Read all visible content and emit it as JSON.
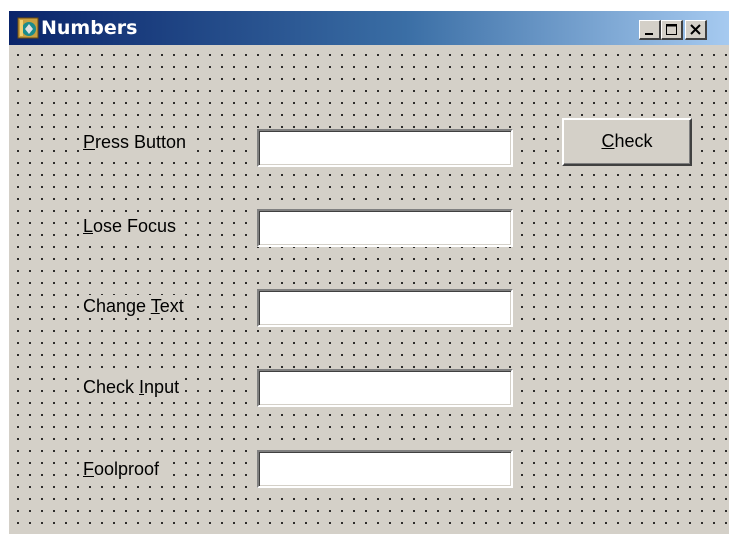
{
  "window": {
    "title": "Numbers",
    "controls": {
      "minimize_icon": "minimize-icon",
      "maximize_icon": "maximize-icon",
      "close_icon": "close-icon"
    }
  },
  "form": {
    "rows": [
      {
        "label_pre": "",
        "label_key": "P",
        "label_post": "ress Button",
        "value": ""
      },
      {
        "label_pre": "",
        "label_key": "L",
        "label_post": "ose Focus",
        "value": ""
      },
      {
        "label_pre": "Change ",
        "label_key": "T",
        "label_post": "ext",
        "value": ""
      },
      {
        "label_pre": "Check ",
        "label_key": "I",
        "label_post": "nput",
        "value": ""
      },
      {
        "label_pre": "",
        "label_key": "F",
        "label_post": "oolproof",
        "value": ""
      }
    ],
    "check_button": {
      "key": "C",
      "rest": "heck"
    }
  }
}
